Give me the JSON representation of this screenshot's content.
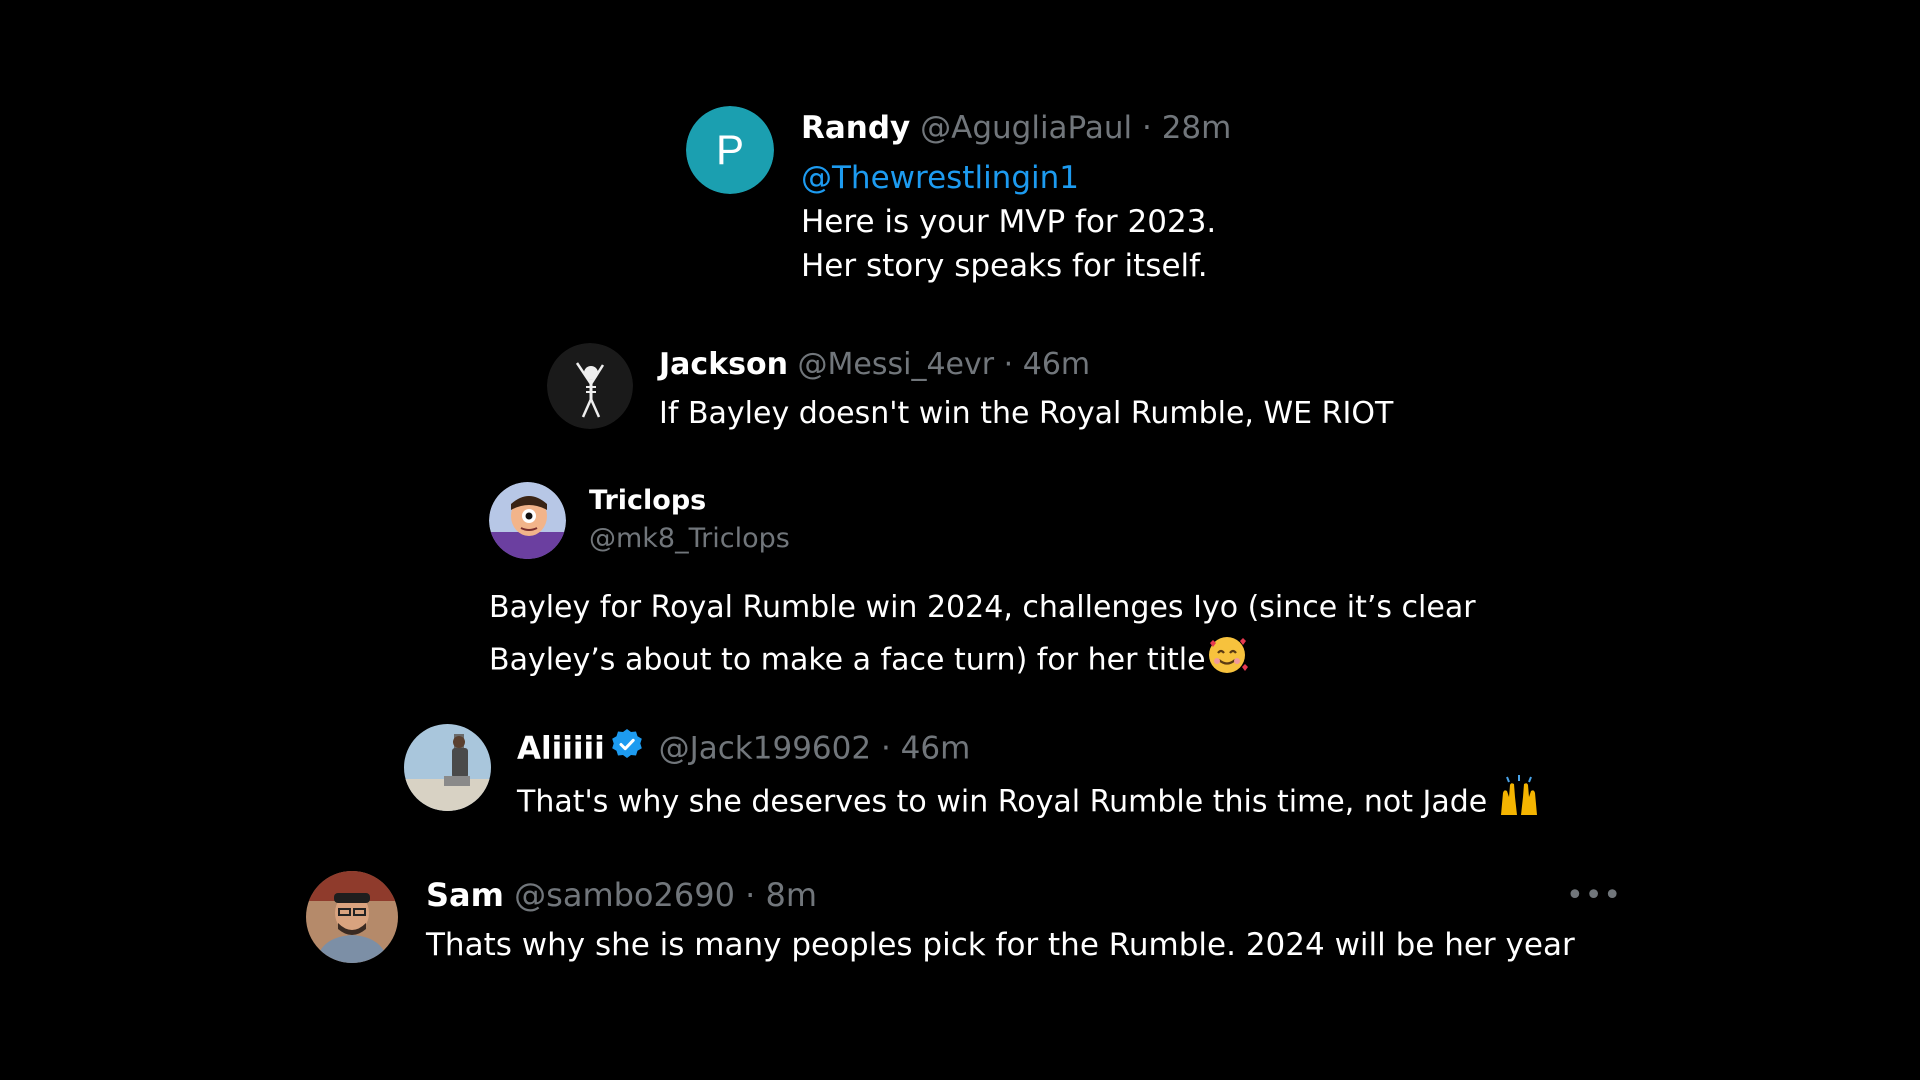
{
  "tweets": [
    {
      "avatar_letter": "P",
      "avatar_color": "#1b9fb0",
      "display_name": "Randy",
      "handle": "@AgugliaPaul",
      "separator": "·",
      "time": "28m",
      "mention": "@Thewrestlingin1",
      "lines": [
        "Here is your MVP for 2023.",
        "Her story speaks for itself."
      ]
    },
    {
      "display_name": "Jackson",
      "handle": "@Messi_4evr",
      "separator": "·",
      "time": "46m",
      "lines": [
        "If Bayley doesn't win the Royal Rumble, WE RIOT"
      ]
    },
    {
      "display_name": "Triclops",
      "handle": "@mk8_Triclops",
      "lines": [
        "Bayley for Royal Rumble win 2024, challenges Iyo (since it’s clear",
        "Bayley’s about to make a face turn) for her title"
      ],
      "emoji": "smiling-face-with-hearts"
    },
    {
      "display_name": "Aliiiii",
      "verified": true,
      "handle": "@Jack199602",
      "separator": "·",
      "time": "46m",
      "lines": [
        "That's why she deserves to win Royal Rumble this time, not Jade"
      ],
      "emoji": "raising-hands"
    },
    {
      "display_name": "Sam",
      "handle": "@sambo2690",
      "separator": "·",
      "time": "8m",
      "more_label": "•••",
      "lines": [
        "Thats why she is many peoples pick for the Rumble. 2024 will be her year"
      ]
    }
  ],
  "colors": {
    "background": "#000000",
    "text": "#ffffff",
    "secondary": "#71767b",
    "link": "#1d9bf0",
    "verified": "#1d9bf0"
  }
}
